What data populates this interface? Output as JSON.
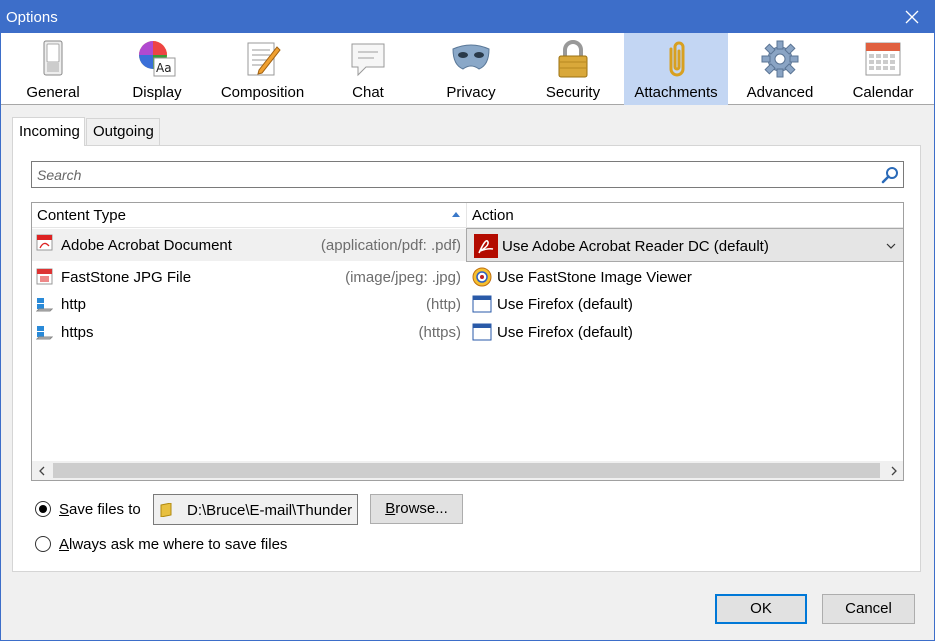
{
  "window": {
    "title": "Options"
  },
  "panes": [
    {
      "label": "General"
    },
    {
      "label": "Display"
    },
    {
      "label": "Composition"
    },
    {
      "label": "Chat"
    },
    {
      "label": "Privacy"
    },
    {
      "label": "Security"
    },
    {
      "label": "Attachments"
    },
    {
      "label": "Advanced"
    },
    {
      "label": "Calendar"
    }
  ],
  "selected_pane": "Attachments",
  "tabs": [
    {
      "label": "Incoming"
    },
    {
      "label": "Outgoing"
    }
  ],
  "selected_tab": "Incoming",
  "search": {
    "placeholder": "Search",
    "value": ""
  },
  "list": {
    "columns": {
      "content_type": "Content Type",
      "action": "Action"
    },
    "rows": [
      {
        "name": "Adobe Acrobat Document",
        "mime": "(application/pdf: .pdf)",
        "action": "Use Adobe Acrobat Reader DC  (default)",
        "icon": "pdf-icon",
        "action_icon": "acrobat-reader-icon"
      },
      {
        "name": "FastStone JPG File",
        "mime": "(image/jpeg: .jpg)",
        "action": "Use FastStone Image Viewer",
        "icon": "jpg-file-icon",
        "action_icon": "faststone-icon"
      },
      {
        "name": "http",
        "mime": "(http)",
        "action": "Use Firefox (default)",
        "icon": "network-icon",
        "action_icon": "app-window-icon"
      },
      {
        "name": "https",
        "mime": "(https)",
        "action": "Use Firefox (default)",
        "icon": "network-icon",
        "action_icon": "app-window-icon"
      }
    ]
  },
  "save": {
    "save_files_to_label": "Save files to",
    "save_files_to_accesskey": "S",
    "save_files_to_rest": "ave files to",
    "path": "D:\\Bruce\\E-mail\\Thunder",
    "browse_label": "Browse...",
    "browse_accesskey": "B",
    "browse_rest": "rowse...",
    "always_ask_label": "Always ask me where to save files",
    "always_ask_accesskey": "A",
    "always_ask_rest": "lways ask me where to save files",
    "selected": "save_files_to"
  },
  "footer": {
    "ok_label": "OK",
    "cancel_label": "Cancel"
  },
  "colors": {
    "titlebar": "#3d6ec9",
    "selected_pane": "#c3d6f3",
    "default_button_border": "#0078d7"
  }
}
